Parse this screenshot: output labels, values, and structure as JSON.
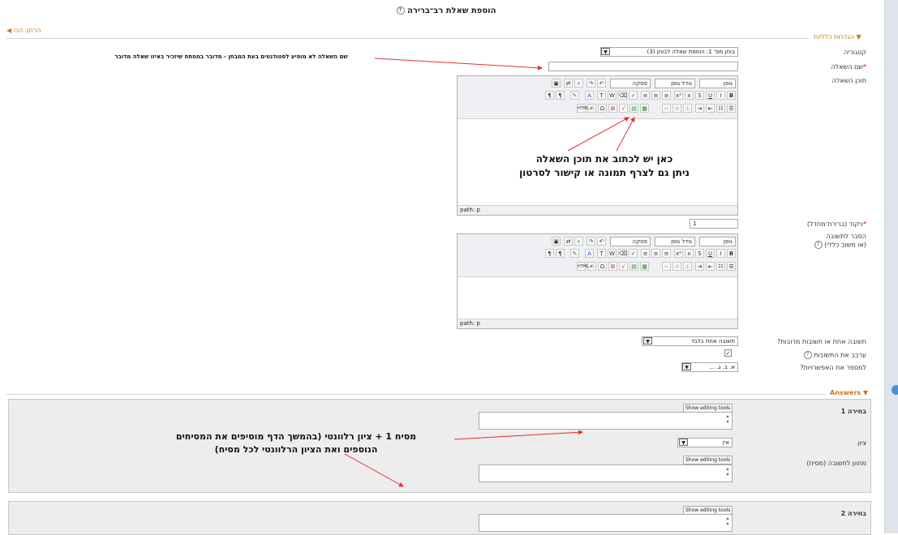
{
  "page": {
    "title": "הוספת שאלת רב־ברירה",
    "back_link": "הרחב הכו"
  },
  "general": {
    "legend": "הגדרות כלליות",
    "category_label": "קטגוריה",
    "category_value": "בוחן מס' 1: הוספת שאלה לבוחן (3)",
    "name_label": "שם השאלה",
    "text_label": "תוכן השאלה",
    "grade_label": "ניקוד (ברירת־מחדל)",
    "grade_value": "1",
    "feedback_label": "הסבר לתשובה",
    "feedback_label2": "(או משוב כללי)",
    "single_label": "תשובה אחת או תשובות מרובות?",
    "single_value": "תשובה אחת בלבד",
    "shuffle_label": "ערבב את התשובות",
    "numbering_label": "למספר את האפשרויות?",
    "numbering_value": "א. ב. ג. ..."
  },
  "editor": {
    "font": "גופן",
    "size": "גודל גופן",
    "paragraph": "פסקה",
    "path": "path: p"
  },
  "answers": {
    "legend": "Answers",
    "choice1": "בחירה 1",
    "choice2": "בחירה 2",
    "grade_label": "ציון",
    "grade_value": "אין",
    "feedback_label": "מחוון לתשובה (מסיח)",
    "show_tools": "Show editing tools"
  },
  "annotations": {
    "name_note": "שם השאלה לא מופיע לסטודנטים בעת המבחן - מדובר במפתח שיזכיר באיזו שאלה מדובר",
    "editor_note_1": "כאן יש לכתוב את תוכן השאלה",
    "editor_note_2": "ניתן גם לצרף תמונה או קישור לסרטון",
    "answers_note_1": "מסיח 1 + ציון רלוונטי (בהמשך הדף מוסיפים את המסיחים",
    "answers_note_2": "הנוספים ואת הציון הרלוונטי לכל מסיח)"
  },
  "colors": {
    "accent": "#c47a1a",
    "arrow": "#e03030",
    "required": "#cc0000"
  }
}
